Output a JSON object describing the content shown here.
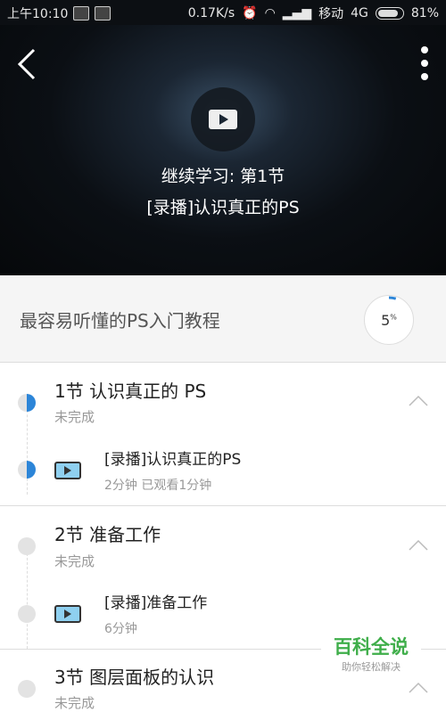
{
  "statusbar": {
    "time": "上午10:10",
    "network_speed": "0.17K/s",
    "carrier": "移动",
    "network_type": "4G",
    "battery": "81%"
  },
  "hero": {
    "continue_label": "继续学习: 第1节",
    "lesson_name": "[录播]认识真正的PS"
  },
  "course": {
    "title": "最容易听懂的PS入门教程",
    "progress_value": "5",
    "progress_unit": "%",
    "progress_fraction": 0.05
  },
  "sections": [
    {
      "title": "1节  认识真正的 PS",
      "status": "未完成",
      "lesson_title": "[录播]认识真正的PS",
      "lesson_meta": "2分钟 已观看1分钟"
    },
    {
      "title": "2节  准备工作",
      "status": "未完成",
      "lesson_title": "[录播]准备工作",
      "lesson_meta": "6分钟"
    },
    {
      "title": "3节  图层面板的认识",
      "status": "未完成"
    }
  ],
  "watermark": {
    "brand": "百科全说",
    "slogan": "助你轻松解决"
  },
  "colors": {
    "accent": "#2c85d8",
    "watermark_green": "#3fae4a"
  }
}
